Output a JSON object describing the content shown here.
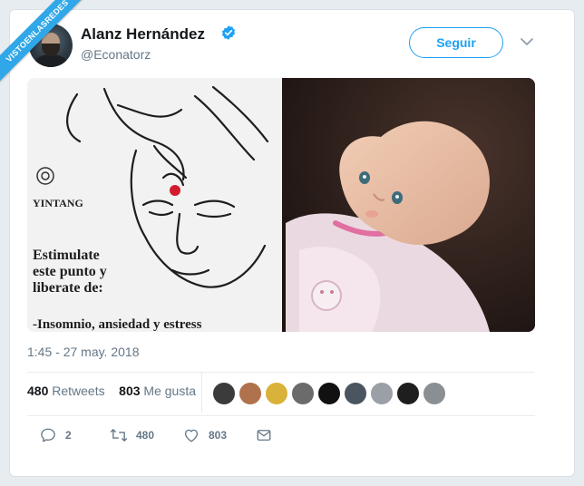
{
  "watermark": "VISTOENLASREDES",
  "tweet": {
    "author_name": "Alanz Hernández",
    "author_handle": "@Econatorz",
    "follow_label": "Seguir",
    "timestamp": "1:45 - 27 may. 2018",
    "retweets_count": "480",
    "retweets_label": "Retweets",
    "likes_count": "803",
    "likes_label": "Me gusta"
  },
  "media_left": {
    "logo_text": "YINTANG",
    "line1": "Estimulate",
    "line2": "este punto y",
    "line3": "liberate de:",
    "line4": "-Insomnio, ansiedad y estress"
  },
  "actions": {
    "reply_count": "2",
    "retweet_count": "480",
    "like_count": "803"
  },
  "icons": [
    "verified-icon",
    "chevron-down-icon",
    "reply-icon",
    "retweet-icon",
    "like-icon",
    "dm-icon"
  ],
  "colors": {
    "accent": "#1da1f2",
    "ribbon": "#2fa7e8",
    "secondary_text": "#657786"
  },
  "liker_colors": [
    "#3b3b3b",
    "#b0724d",
    "#d9b23a",
    "#6b6b6b",
    "#111111",
    "#4a5560",
    "#9aa0a6",
    "#1e1e1e",
    "#8a8f94"
  ]
}
